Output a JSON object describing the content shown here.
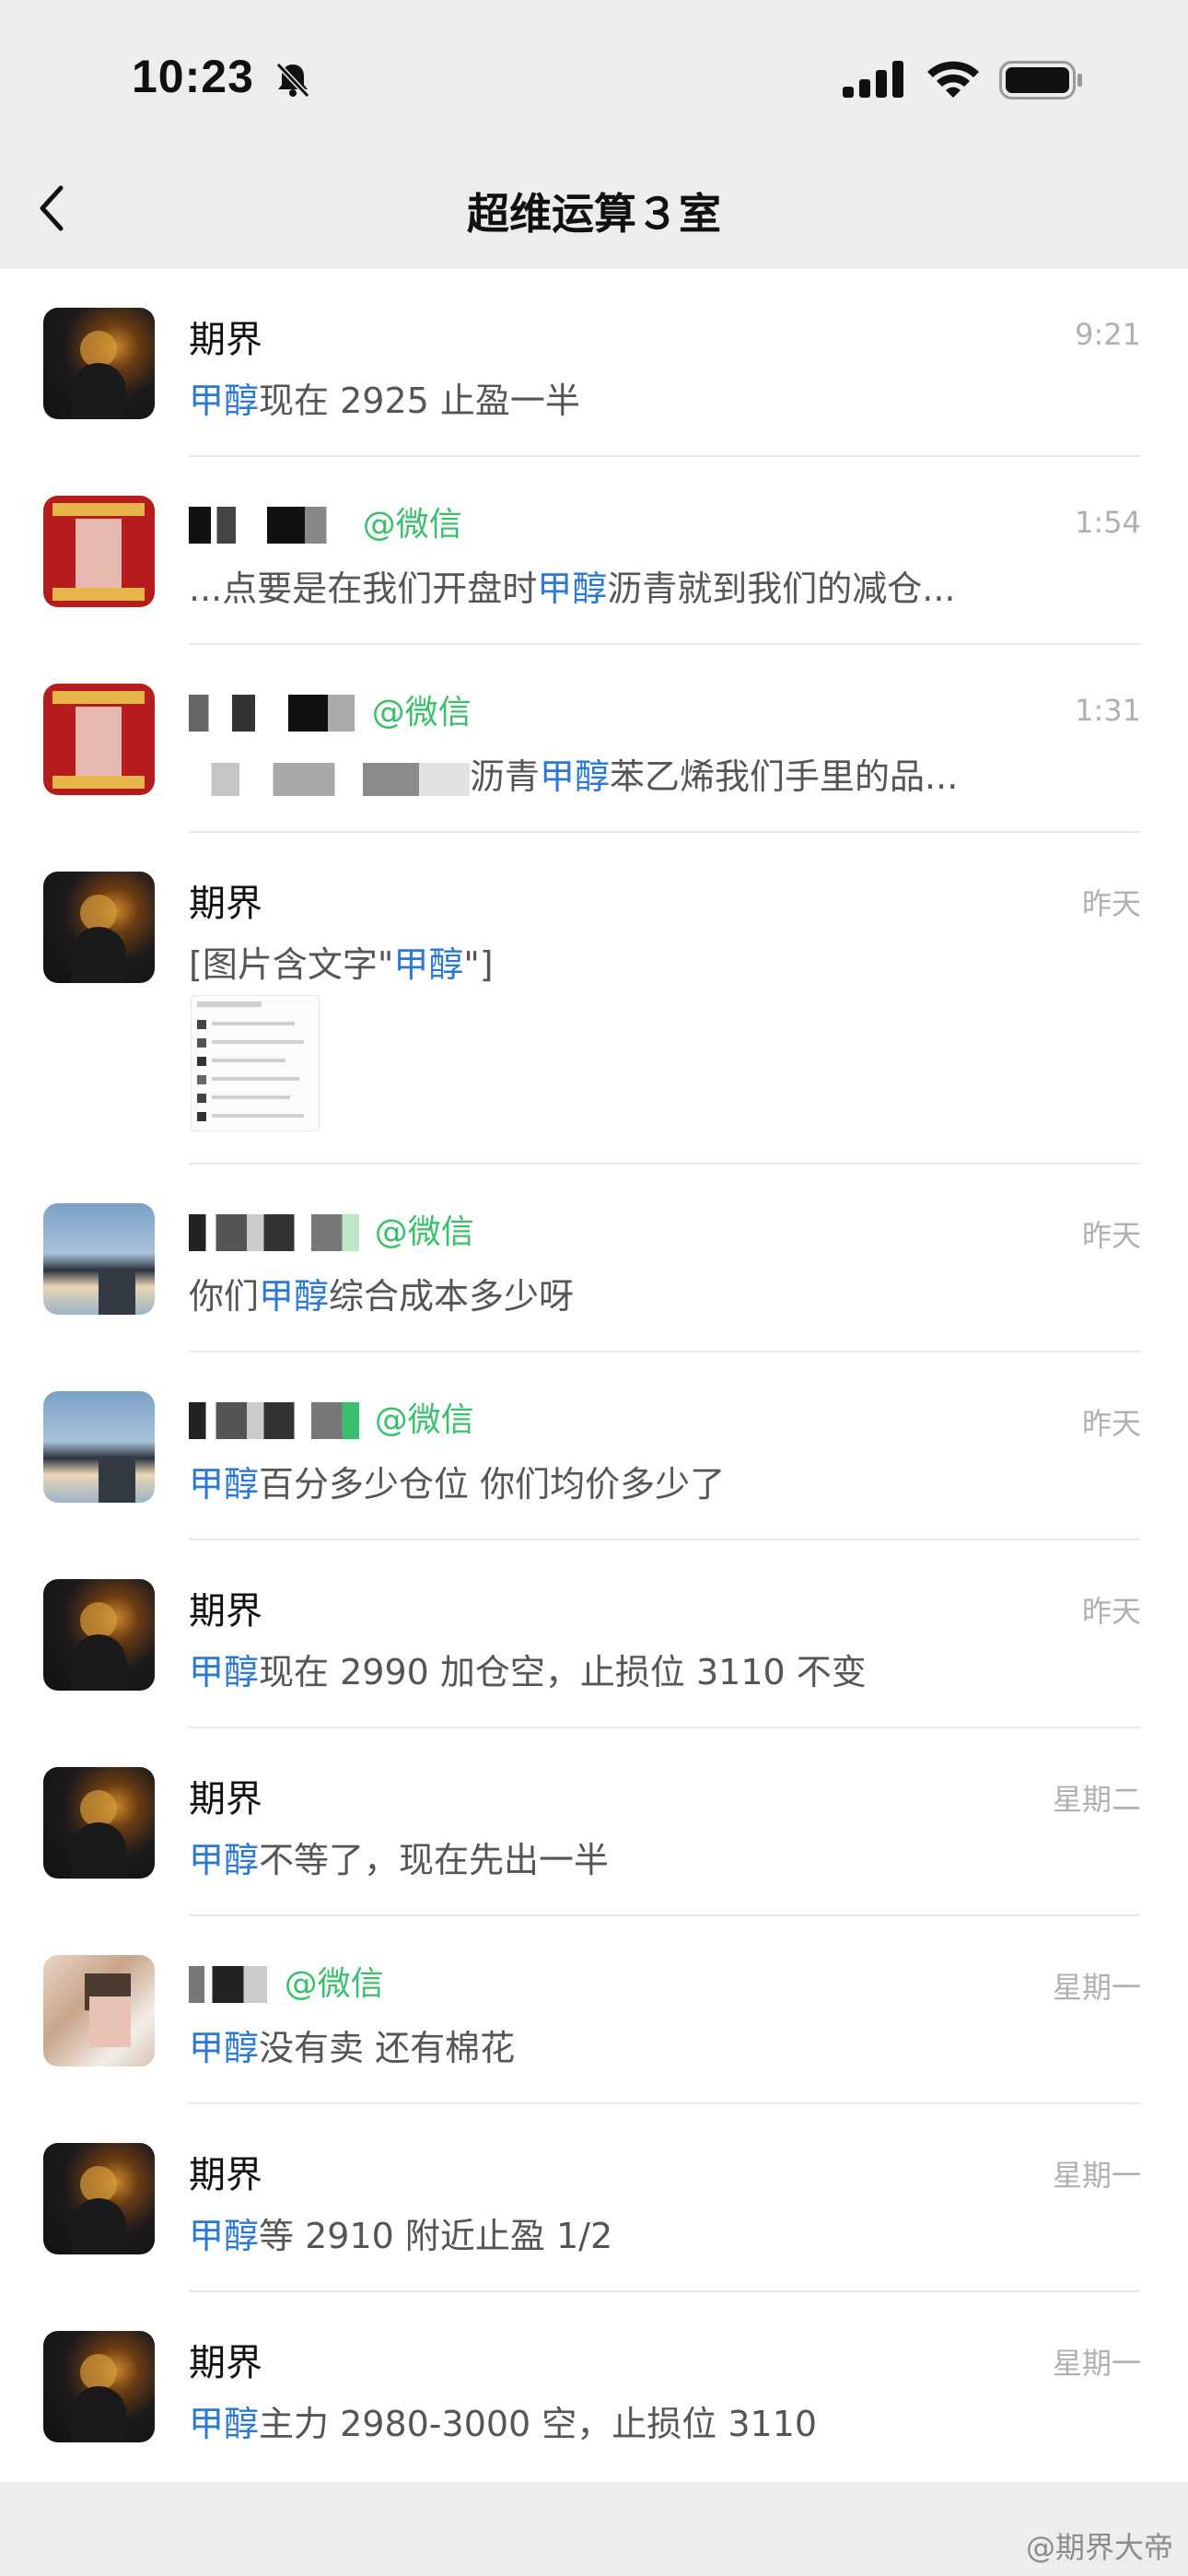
{
  "status_bar": {
    "time": "10:23",
    "icons": [
      "bell-slash-icon",
      "signal-icon",
      "wifi-icon",
      "battery-icon"
    ]
  },
  "nav": {
    "back_icon": "chevron-left-icon",
    "title": "超维运算３室"
  },
  "colors": {
    "highlight": "#2c79d4",
    "wechat_source": "#3bbf6c",
    "timestamp": "#b0b0b0"
  },
  "items": [
    {
      "name": "期界",
      "source": "",
      "time": "9:21",
      "snippet": [
        {
          "t": "甲醇",
          "hl": true
        },
        {
          "t": "现在 2925 止盈一半",
          "hl": false
        }
      ]
    },
    {
      "name": "",
      "source": "@微信",
      "time": "1:54",
      "snippet": [
        {
          "t": "...点要是在我们开盘时",
          "hl": false
        },
        {
          "t": "甲醇",
          "hl": true
        },
        {
          "t": "沥青就到我们的减仓...",
          "hl": false
        }
      ]
    },
    {
      "name": "",
      "source": "@微信",
      "time": "1:31",
      "snippet": [
        {
          "t": "沥青",
          "hl": false
        },
        {
          "t": "甲醇",
          "hl": true
        },
        {
          "t": "苯乙烯我们手里的品...",
          "hl": false
        }
      ]
    },
    {
      "name": "期界",
      "source": "",
      "time": "昨天",
      "snippet": [
        {
          "t": "[图片含文字\"",
          "hl": false
        },
        {
          "t": "甲醇",
          "hl": true
        },
        {
          "t": "\"]",
          "hl": false
        }
      ]
    },
    {
      "name": "",
      "source": "@微信",
      "time": "昨天",
      "snippet": [
        {
          "t": "你们",
          "hl": false
        },
        {
          "t": "甲醇",
          "hl": true
        },
        {
          "t": "综合成本多少呀",
          "hl": false
        }
      ]
    },
    {
      "name": "",
      "source": "@微信",
      "time": "昨天",
      "snippet": [
        {
          "t": "甲醇",
          "hl": true
        },
        {
          "t": "百分多少仓位 你们均价多少了",
          "hl": false
        }
      ]
    },
    {
      "name": "期界",
      "source": "",
      "time": "昨天",
      "snippet": [
        {
          "t": "甲醇",
          "hl": true
        },
        {
          "t": "现在 2990 加仓空，止损位 3110 不变",
          "hl": false
        }
      ]
    },
    {
      "name": "期界",
      "source": "",
      "time": "星期二",
      "snippet": [
        {
          "t": "甲醇",
          "hl": true
        },
        {
          "t": "不等了，现在先出一半",
          "hl": false
        }
      ]
    },
    {
      "name": "",
      "source": "@微信",
      "time": "星期一",
      "snippet": [
        {
          "t": "甲醇",
          "hl": true
        },
        {
          "t": "没有卖 还有棉花",
          "hl": false
        }
      ]
    },
    {
      "name": "期界",
      "source": "",
      "time": "星期一",
      "snippet": [
        {
          "t": "甲醇",
          "hl": true
        },
        {
          "t": "等 2910 附近止盈 1/2",
          "hl": false
        }
      ]
    },
    {
      "name": "期界",
      "source": "",
      "time": "星期一",
      "snippet": [
        {
          "t": "甲醇",
          "hl": true
        },
        {
          "t": "主力 2980-3000 空，止损位 3110",
          "hl": false
        }
      ]
    }
  ],
  "watermark": "@期界大帝"
}
